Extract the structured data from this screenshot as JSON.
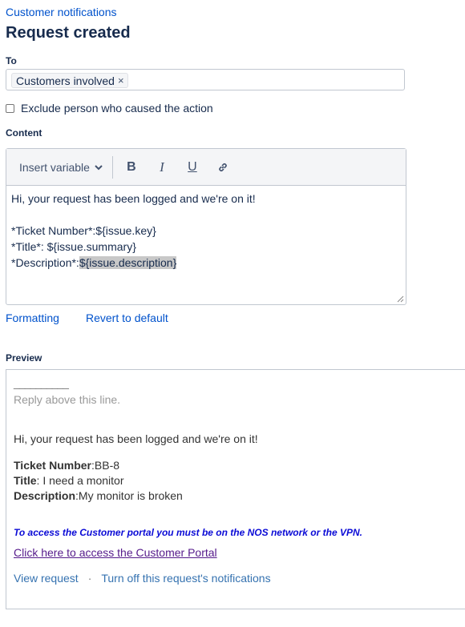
{
  "header": {
    "breadcrumb": "Customer notifications",
    "title": "Request created"
  },
  "to": {
    "label": "To",
    "tags": [
      "Customers involved"
    ],
    "remove_glyph": "×"
  },
  "exclude": {
    "label": "Exclude person who caused the action",
    "checked": false
  },
  "content": {
    "label": "Content",
    "toolbar": {
      "insert_variable": "Insert variable",
      "bold": "B",
      "italic": "I",
      "underline": "U",
      "icons": [
        "chevron-down-icon",
        "link-icon"
      ]
    },
    "lines": [
      "Hi, your request has been logged and we're on it!",
      "",
      "*Ticket Number*:${issue.key}",
      "*Title*: ${issue.summary}",
      "*Description*:"
    ],
    "highlighted": "${issue.description}"
  },
  "links": {
    "formatting": "Formatting",
    "revert": "Revert to default"
  },
  "preview": {
    "label": "Preview",
    "rule": "__________",
    "reply_line": "Reply above this line.",
    "greeting": "Hi, your request has been logged and we're on it!",
    "fields": [
      {
        "key": "Ticket Number",
        "sep": ":",
        "value": "BB-8"
      },
      {
        "key": "Title",
        "sep": ": ",
        "value": "I need a monitor"
      },
      {
        "key": "Description",
        "sep": ":",
        "value": "My monitor is broken"
      }
    ],
    "notice": "To access the Customer portal you must be on the NOS network or the VPN.",
    "portal_link": "Click here to access the Customer Portal",
    "view_request": "View request",
    "separator": "·",
    "turn_off": "Turn off this request's notifications"
  }
}
